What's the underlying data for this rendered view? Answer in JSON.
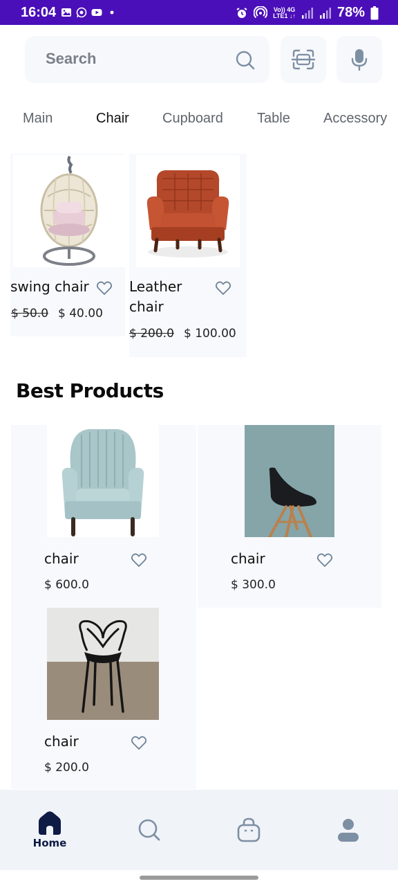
{
  "status_bar": {
    "time": "16:04",
    "battery": "78%",
    "network_top": "Vo)) 4G",
    "network_bottom": "LTE1 ↓↑",
    "left_icons": [
      "gallery-icon",
      "whatsapp-icon",
      "youtube-icon",
      "dot-icon"
    ],
    "right_icons": [
      "alarm-icon",
      "hotspot-icon",
      "signal-icon",
      "signal-icon",
      "battery-icon"
    ]
  },
  "search": {
    "placeholder": "Search",
    "icon": "search-icon",
    "scan_icon": "scan-icon",
    "mic_icon": "mic-icon"
  },
  "tabs": [
    {
      "label": "Main",
      "active": false
    },
    {
      "label": "Chair",
      "active": true
    },
    {
      "label": "Cupboard",
      "active": false
    },
    {
      "label": "Table",
      "active": false
    },
    {
      "label": "Accessory",
      "active": false
    }
  ],
  "featured": [
    {
      "name": "swing chair",
      "old_price": "$ 50.0",
      "price": "$ 40.00",
      "image": "swing-chair-image"
    },
    {
      "name": "Leather chair",
      "name_line1": "Leather",
      "name_line2": "chair",
      "old_price": "$ 200.0",
      "price": "$ 100.00",
      "image": "leather-chair-image"
    }
  ],
  "best_products": {
    "title": "Best Products",
    "items": [
      {
        "name": "chair",
        "price": "$ 600.0",
        "image": "wingback-chair-image"
      },
      {
        "name": "chair",
        "price": "$ 300.0",
        "image": "black-shell-chair-image"
      },
      {
        "name": "chair",
        "price": "$ 200.0",
        "image": "masters-chair-image"
      }
    ]
  },
  "bottom_nav": [
    {
      "label": "Home",
      "icon": "home-icon",
      "active": true
    },
    {
      "label": "",
      "icon": "search-icon",
      "active": false
    },
    {
      "label": "",
      "icon": "bag-icon",
      "active": false
    },
    {
      "label": "",
      "icon": "profile-icon",
      "active": false
    }
  ],
  "colors": {
    "status_bar": "#4a0fb8",
    "card_bg": "#f7f9fc",
    "nav_bg": "#f0f3f8",
    "nav_active": "#0d1b45",
    "icon_inactive": "#7d8fa3"
  }
}
